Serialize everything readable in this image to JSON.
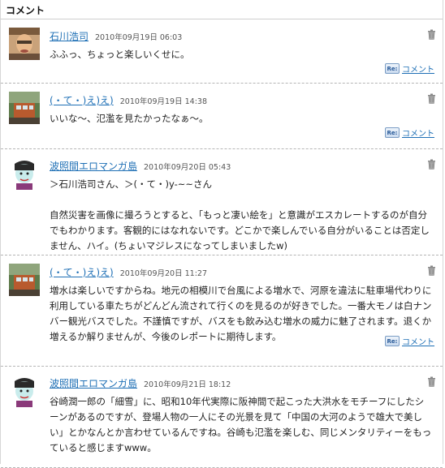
{
  "section": {
    "title": "コメント"
  },
  "reply_label": "コメント",
  "reply_icon_text": "Re:",
  "comments": [
    {
      "name": "石川浩司",
      "date": "2010年09月19日 06:03",
      "paragraphs": [
        "ふふっ、ちょっと楽しいくせに。"
      ],
      "avatar": "avatar-man-photo",
      "has_reply": true
    },
    {
      "name": "(・て・)え)え)",
      "date": "2010年09月19日 14:38",
      "paragraphs": [
        "いいな〜、氾濫を見たかったなぁ〜。"
      ],
      "avatar": "avatar-train-photo",
      "has_reply": true
    },
    {
      "name": "波照間エロマンガ島",
      "date": "2010年09月20日 05:43",
      "paragraphs": [
        "＞石川浩司さん、＞(・て・)y-~~さん",
        "自然災害を画像に撮ろうとすると、「もっと凄い絵を」と意識がエスカレートするのが自分でもわかります。客観的にはなれないです。どこかで楽しんでいる自分がいることは否定しません、ハイ。(ちょいマジレスになってしまいましたw)"
      ],
      "avatar": "avatar-cartoon-face",
      "has_reply": false
    },
    {
      "name": "(・て・)え)え)",
      "date": "2010年09月20日 11:27",
      "paragraphs": [
        "増水は楽しいですからね。地元の相模川で台風による増水で、河原を違法に駐車場代わりに利用している車たちがどんどん流されて行くのを見るのが好きでした。一番大モノは白ナンバー観光バスでした。不謹慎ですが、バスをも飲み込む増水の威力に魅了されます。退くか増えるか解りませんが、今後のレポートに期待します。"
      ],
      "avatar": "avatar-train-photo",
      "has_reply": true
    },
    {
      "name": "波照間エロマンガ島",
      "date": "2010年09月21日 18:12",
      "paragraphs": [
        "谷崎潤一郎の「細雪」に、昭和10年代実際に阪神間で起こった大洪水をモチーフにしたシーンがあるのですが、登場人物の一人にその光景を見て「中国の大河のようで雄大で美しい」とかなんとか言わせているんですね。谷崎も氾濫を楽しむ、同じメンタリティーをもっていると感じますwww。"
      ],
      "avatar": "avatar-cartoon-face",
      "has_reply": false
    }
  ],
  "colors": {
    "link": "#1e6fb5",
    "divider": "#b5b5b5"
  }
}
